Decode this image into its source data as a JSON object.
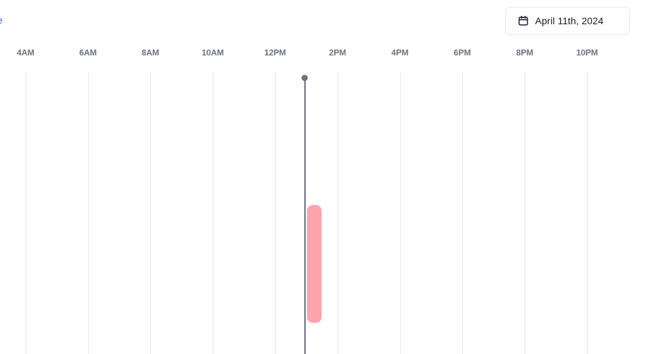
{
  "left_edge_text": "e",
  "date_picker": {
    "icon": "calendar-icon",
    "label": "April 11th, 2024"
  },
  "timeline": {
    "hours": [
      "4AM",
      "6AM",
      "8AM",
      "10AM",
      "12PM",
      "2PM",
      "4PM",
      "6PM",
      "8PM",
      "10PM"
    ],
    "current_time_indicator": true,
    "events": [
      {
        "color": "#fda4af"
      }
    ]
  },
  "colors": {
    "grid": "#e5e7eb",
    "hour_label": "#6b7280",
    "now_line": "#6b7280",
    "event": "#fda4af",
    "date_text": "#111827"
  }
}
